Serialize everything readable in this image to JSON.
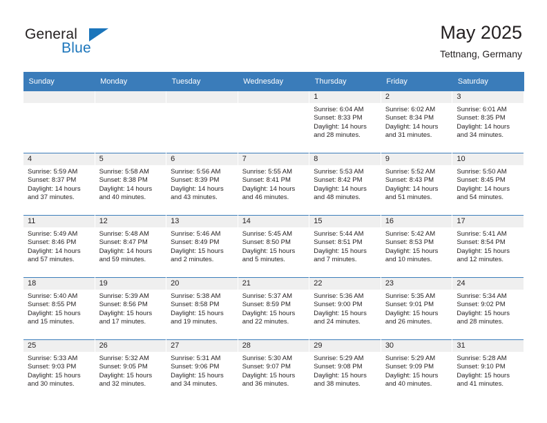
{
  "brand": {
    "name_part1": "General",
    "name_part2": "Blue"
  },
  "header": {
    "title": "May 2025",
    "subtitle": "Tettnang, Germany"
  },
  "colors": {
    "header_blue": "#3a7cba",
    "brand_blue": "#1b75bb",
    "daynum_band": "#efefef",
    "text": "#231f20"
  },
  "weekdays": [
    "Sunday",
    "Monday",
    "Tuesday",
    "Wednesday",
    "Thursday",
    "Friday",
    "Saturday"
  ],
  "weeks": [
    [
      {
        "day": "",
        "sunrise": "",
        "sunset": "",
        "daylight_line1": "",
        "daylight_line2": ""
      },
      {
        "day": "",
        "sunrise": "",
        "sunset": "",
        "daylight_line1": "",
        "daylight_line2": ""
      },
      {
        "day": "",
        "sunrise": "",
        "sunset": "",
        "daylight_line1": "",
        "daylight_line2": ""
      },
      {
        "day": "",
        "sunrise": "",
        "sunset": "",
        "daylight_line1": "",
        "daylight_line2": ""
      },
      {
        "day": "1",
        "sunrise": "Sunrise: 6:04 AM",
        "sunset": "Sunset: 8:33 PM",
        "daylight_line1": "Daylight: 14 hours",
        "daylight_line2": "and 28 minutes."
      },
      {
        "day": "2",
        "sunrise": "Sunrise: 6:02 AM",
        "sunset": "Sunset: 8:34 PM",
        "daylight_line1": "Daylight: 14 hours",
        "daylight_line2": "and 31 minutes."
      },
      {
        "day": "3",
        "sunrise": "Sunrise: 6:01 AM",
        "sunset": "Sunset: 8:35 PM",
        "daylight_line1": "Daylight: 14 hours",
        "daylight_line2": "and 34 minutes."
      }
    ],
    [
      {
        "day": "4",
        "sunrise": "Sunrise: 5:59 AM",
        "sunset": "Sunset: 8:37 PM",
        "daylight_line1": "Daylight: 14 hours",
        "daylight_line2": "and 37 minutes."
      },
      {
        "day": "5",
        "sunrise": "Sunrise: 5:58 AM",
        "sunset": "Sunset: 8:38 PM",
        "daylight_line1": "Daylight: 14 hours",
        "daylight_line2": "and 40 minutes."
      },
      {
        "day": "6",
        "sunrise": "Sunrise: 5:56 AM",
        "sunset": "Sunset: 8:39 PM",
        "daylight_line1": "Daylight: 14 hours",
        "daylight_line2": "and 43 minutes."
      },
      {
        "day": "7",
        "sunrise": "Sunrise: 5:55 AM",
        "sunset": "Sunset: 8:41 PM",
        "daylight_line1": "Daylight: 14 hours",
        "daylight_line2": "and 46 minutes."
      },
      {
        "day": "8",
        "sunrise": "Sunrise: 5:53 AM",
        "sunset": "Sunset: 8:42 PM",
        "daylight_line1": "Daylight: 14 hours",
        "daylight_line2": "and 48 minutes."
      },
      {
        "day": "9",
        "sunrise": "Sunrise: 5:52 AM",
        "sunset": "Sunset: 8:43 PM",
        "daylight_line1": "Daylight: 14 hours",
        "daylight_line2": "and 51 minutes."
      },
      {
        "day": "10",
        "sunrise": "Sunrise: 5:50 AM",
        "sunset": "Sunset: 8:45 PM",
        "daylight_line1": "Daylight: 14 hours",
        "daylight_line2": "and 54 minutes."
      }
    ],
    [
      {
        "day": "11",
        "sunrise": "Sunrise: 5:49 AM",
        "sunset": "Sunset: 8:46 PM",
        "daylight_line1": "Daylight: 14 hours",
        "daylight_line2": "and 57 minutes."
      },
      {
        "day": "12",
        "sunrise": "Sunrise: 5:48 AM",
        "sunset": "Sunset: 8:47 PM",
        "daylight_line1": "Daylight: 14 hours",
        "daylight_line2": "and 59 minutes."
      },
      {
        "day": "13",
        "sunrise": "Sunrise: 5:46 AM",
        "sunset": "Sunset: 8:49 PM",
        "daylight_line1": "Daylight: 15 hours",
        "daylight_line2": "and 2 minutes."
      },
      {
        "day": "14",
        "sunrise": "Sunrise: 5:45 AM",
        "sunset": "Sunset: 8:50 PM",
        "daylight_line1": "Daylight: 15 hours",
        "daylight_line2": "and 5 minutes."
      },
      {
        "day": "15",
        "sunrise": "Sunrise: 5:44 AM",
        "sunset": "Sunset: 8:51 PM",
        "daylight_line1": "Daylight: 15 hours",
        "daylight_line2": "and 7 minutes."
      },
      {
        "day": "16",
        "sunrise": "Sunrise: 5:42 AM",
        "sunset": "Sunset: 8:53 PM",
        "daylight_line1": "Daylight: 15 hours",
        "daylight_line2": "and 10 minutes."
      },
      {
        "day": "17",
        "sunrise": "Sunrise: 5:41 AM",
        "sunset": "Sunset: 8:54 PM",
        "daylight_line1": "Daylight: 15 hours",
        "daylight_line2": "and 12 minutes."
      }
    ],
    [
      {
        "day": "18",
        "sunrise": "Sunrise: 5:40 AM",
        "sunset": "Sunset: 8:55 PM",
        "daylight_line1": "Daylight: 15 hours",
        "daylight_line2": "and 15 minutes."
      },
      {
        "day": "19",
        "sunrise": "Sunrise: 5:39 AM",
        "sunset": "Sunset: 8:56 PM",
        "daylight_line1": "Daylight: 15 hours",
        "daylight_line2": "and 17 minutes."
      },
      {
        "day": "20",
        "sunrise": "Sunrise: 5:38 AM",
        "sunset": "Sunset: 8:58 PM",
        "daylight_line1": "Daylight: 15 hours",
        "daylight_line2": "and 19 minutes."
      },
      {
        "day": "21",
        "sunrise": "Sunrise: 5:37 AM",
        "sunset": "Sunset: 8:59 PM",
        "daylight_line1": "Daylight: 15 hours",
        "daylight_line2": "and 22 minutes."
      },
      {
        "day": "22",
        "sunrise": "Sunrise: 5:36 AM",
        "sunset": "Sunset: 9:00 PM",
        "daylight_line1": "Daylight: 15 hours",
        "daylight_line2": "and 24 minutes."
      },
      {
        "day": "23",
        "sunrise": "Sunrise: 5:35 AM",
        "sunset": "Sunset: 9:01 PM",
        "daylight_line1": "Daylight: 15 hours",
        "daylight_line2": "and 26 minutes."
      },
      {
        "day": "24",
        "sunrise": "Sunrise: 5:34 AM",
        "sunset": "Sunset: 9:02 PM",
        "daylight_line1": "Daylight: 15 hours",
        "daylight_line2": "and 28 minutes."
      }
    ],
    [
      {
        "day": "25",
        "sunrise": "Sunrise: 5:33 AM",
        "sunset": "Sunset: 9:03 PM",
        "daylight_line1": "Daylight: 15 hours",
        "daylight_line2": "and 30 minutes."
      },
      {
        "day": "26",
        "sunrise": "Sunrise: 5:32 AM",
        "sunset": "Sunset: 9:05 PM",
        "daylight_line1": "Daylight: 15 hours",
        "daylight_line2": "and 32 minutes."
      },
      {
        "day": "27",
        "sunrise": "Sunrise: 5:31 AM",
        "sunset": "Sunset: 9:06 PM",
        "daylight_line1": "Daylight: 15 hours",
        "daylight_line2": "and 34 minutes."
      },
      {
        "day": "28",
        "sunrise": "Sunrise: 5:30 AM",
        "sunset": "Sunset: 9:07 PM",
        "daylight_line1": "Daylight: 15 hours",
        "daylight_line2": "and 36 minutes."
      },
      {
        "day": "29",
        "sunrise": "Sunrise: 5:29 AM",
        "sunset": "Sunset: 9:08 PM",
        "daylight_line1": "Daylight: 15 hours",
        "daylight_line2": "and 38 minutes."
      },
      {
        "day": "30",
        "sunrise": "Sunrise: 5:29 AM",
        "sunset": "Sunset: 9:09 PM",
        "daylight_line1": "Daylight: 15 hours",
        "daylight_line2": "and 40 minutes."
      },
      {
        "day": "31",
        "sunrise": "Sunrise: 5:28 AM",
        "sunset": "Sunset: 9:10 PM",
        "daylight_line1": "Daylight: 15 hours",
        "daylight_line2": "and 41 minutes."
      }
    ]
  ]
}
